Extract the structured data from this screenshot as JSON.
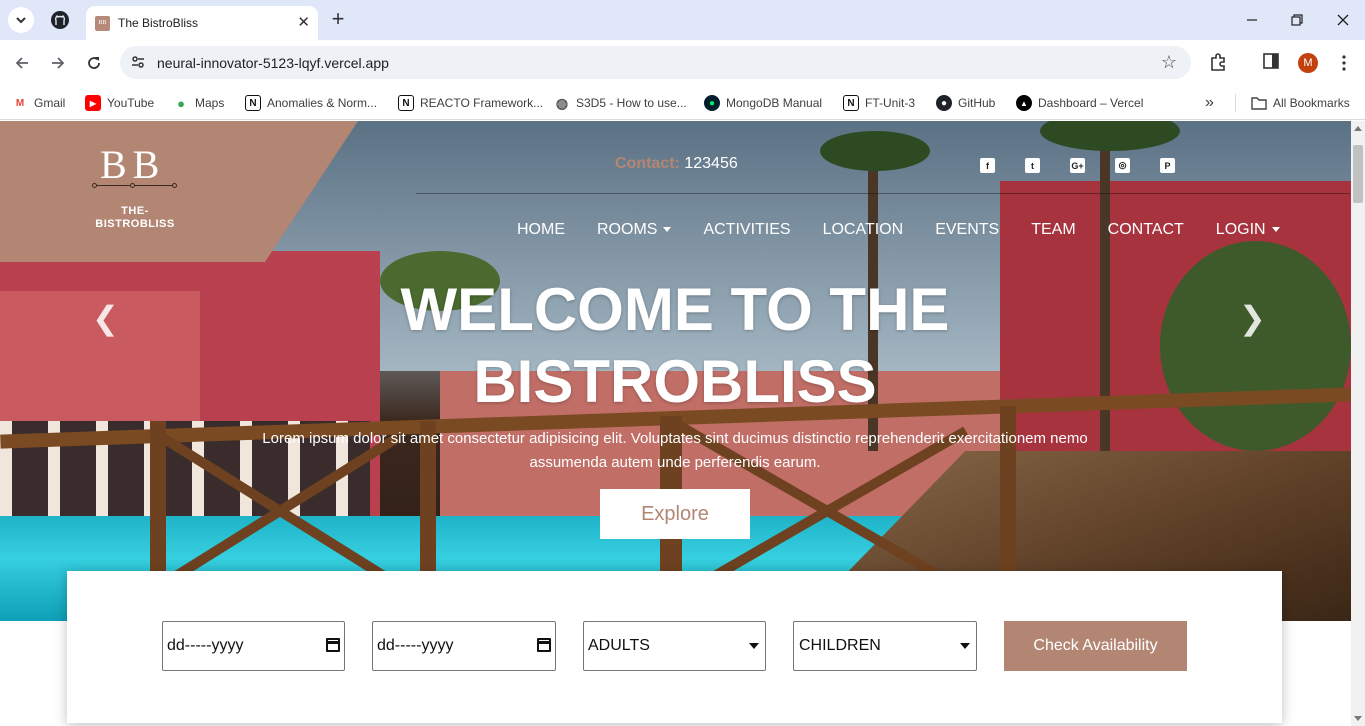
{
  "browser": {
    "tab": {
      "title": "The BistroBliss",
      "favicon_text": "BB",
      "close_glyph": "✕"
    },
    "new_tab_glyph": "+",
    "address": {
      "url": "neural-innovator-5123-lqyf.vercel.app"
    },
    "profile_initial": "M",
    "bookmarks": [
      {
        "label": "Gmail",
        "icon": "gmail-icon"
      },
      {
        "label": "YouTube",
        "icon": "youtube-icon"
      },
      {
        "label": "Maps",
        "icon": "maps-icon"
      },
      {
        "label": "Anomalies & Norm...",
        "icon": "notion-icon"
      },
      {
        "label": "REACTO Framework...",
        "icon": "notion-icon"
      },
      {
        "label": "S3D5 - How to use...",
        "icon": "globe-icon"
      },
      {
        "label": "MongoDB Manual",
        "icon": "mongodb-icon"
      },
      {
        "label": "FT-Unit-3",
        "icon": "notion-icon"
      },
      {
        "label": "GitHub",
        "icon": "github-icon"
      },
      {
        "label": "Dashboard – Vercel",
        "icon": "vercel-icon"
      }
    ],
    "overflow_glyph": "»",
    "all_bookmarks": "All Bookmarks"
  },
  "header": {
    "logo_mark": "BB",
    "logo_name_line1": "THE-",
    "logo_name_line2": "BISTROBLISS",
    "contact_label": "Contact:",
    "contact_number": "123456",
    "social": [
      {
        "name": "facebook-icon",
        "glyph": "f"
      },
      {
        "name": "twitter-icon",
        "glyph": "t"
      },
      {
        "name": "google-plus-icon",
        "glyph": "G+"
      },
      {
        "name": "instagram-icon",
        "glyph": "◎"
      },
      {
        "name": "pinterest-icon",
        "glyph": "P"
      }
    ],
    "nav": [
      {
        "label": "HOME",
        "dropdown": false
      },
      {
        "label": "ROOMS",
        "dropdown": true
      },
      {
        "label": "ACTIVITIES",
        "dropdown": false
      },
      {
        "label": "LOCATION",
        "dropdown": false
      },
      {
        "label": "EVENTS",
        "dropdown": false
      },
      {
        "label": "TEAM",
        "dropdown": false
      },
      {
        "label": "CONTACT",
        "dropdown": false
      },
      {
        "label": "LOGIN",
        "dropdown": true
      }
    ]
  },
  "hero": {
    "title_line1": "WELCOME TO THE",
    "title_line2": "BISTROBLISS",
    "subtitle_line1": "Lorem ipsum dolor sit amet consectetur adipisicing elit. Voluptates sint ducimus distinctio reprehenderit exercitationem nemo",
    "subtitle_line2": "assumenda autem unde perferendis earum.",
    "explore_label": "Explore",
    "prev_glyph": "❮",
    "next_glyph": "❯"
  },
  "booking": {
    "checkin_placeholder": "dd-----yyyy",
    "checkout_placeholder": "dd-----yyyy",
    "adults_selected": "ADULTS",
    "children_selected": "CHILDREN",
    "check_label": "Check Availability"
  },
  "colors": {
    "accent": "#b38674",
    "tabstrip": "#dfe7f8",
    "avatar": "#c2410c"
  }
}
